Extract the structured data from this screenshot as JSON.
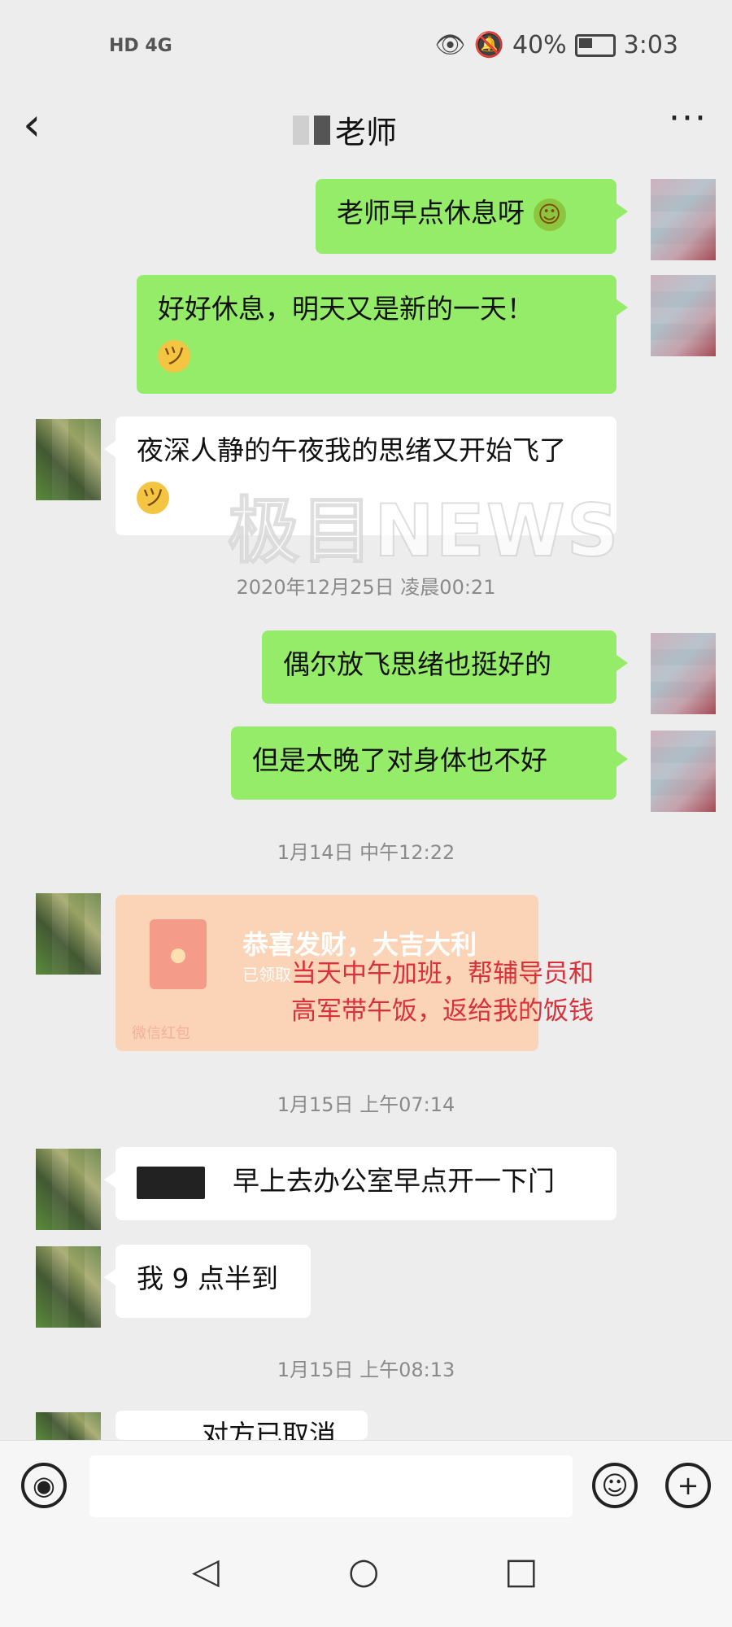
{
  "status_bar": {
    "network": "HD 4G",
    "battery": "40%",
    "time": "3:03"
  },
  "header": {
    "back_icon": "chevron-left-icon",
    "title": "老师",
    "more_icon": "more-dots-icon"
  },
  "messages": {
    "m1": "老师早点休息呀",
    "m2": "好好休息，明天又是新的一天！",
    "m3": "夜深人静的午夜我的思绪又开始飞了",
    "t1": "2020年12月25日 凌晨00:21",
    "m4": "偶尔放飞思绪也挺好的",
    "m5": "但是太晚了对身体也不好",
    "t2": "1月14日 中午12:22",
    "red_packet": {
      "title": "恭喜发财，大吉大利",
      "subtitle": "已领取",
      "footer": "微信红包"
    },
    "annotation": [
      "当天中午加班，帮辅导员和",
      "高军带午饭，返给我的饭钱"
    ],
    "t3": "1月15日 上午07:14",
    "m6": "早上去办公室早点开一下门",
    "m7": "我 9 点半到",
    "t4": "1月15日 上午08:13",
    "m8": "对方已取消"
  },
  "watermark": "极目NEWS",
  "input_bar": {
    "voice_icon": "voice-icon",
    "emoji_icon": "smiley-icon",
    "plus_icon": "plus-icon"
  },
  "nav_bar": {
    "back": "◁",
    "home": "○",
    "recents": "□"
  }
}
